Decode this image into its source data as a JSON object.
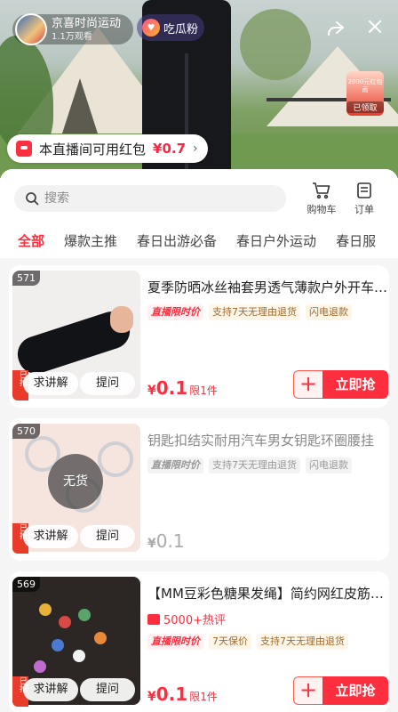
{
  "live": {
    "anchor_name": "京喜时尚运动",
    "anchor_views": "1.1万观看",
    "follow_label": "吃瓜粉",
    "redpack_amount": "2000元红包雨",
    "redpack_status": "已领取",
    "coupon_text": "本直播间可用红包",
    "coupon_amount": "¥0.7",
    "coupon_arrow": "›"
  },
  "sheet": {
    "search_placeholder": "搜索",
    "cart_label": "购物车",
    "orders_label": "订单",
    "tabs": [
      "全部",
      "爆款主推",
      "春日出游必备",
      "春日户外运动",
      "春日服"
    ]
  },
  "products": [
    {
      "rank": "571",
      "title": "夏季防晒冰丝袖套男透气薄款户外开车骑行",
      "tags": [
        "直播限时价",
        "支持7天无理由退货",
        "闪电退款"
      ],
      "price_symbol": "¥",
      "price": "0.1",
      "price_note": "限1件",
      "ask_label": "求讲解",
      "quiz_label": "提问",
      "buy_label": "立即抢",
      "add_label": "+",
      "side_tag": "已抢"
    },
    {
      "rank": "570",
      "title": "钥匙扣结实耐用汽车男女钥匙环圈腰挂",
      "tags": [
        "直播限时价",
        "支持7天无理由退货",
        "闪电退款"
      ],
      "price_symbol": "¥",
      "price": "0.1",
      "soldout_label": "无货",
      "ask_label": "求讲解",
      "quiz_label": "提问",
      "side_tag": "已抢"
    },
    {
      "rank": "569",
      "title": "【MM豆彩色糖果发绳】简约网红皮筋头绳",
      "hot": "5000+热评",
      "tags": [
        "直播限时价",
        "7天保价",
        "支持7天无理由退货"
      ],
      "price_symbol": "¥",
      "price": "0.1",
      "price_note": "限1件",
      "ask_label": "求讲解",
      "quiz_label": "提问",
      "buy_label": "立即抢",
      "add_label": "+",
      "side_tag": "已抢"
    }
  ],
  "colors": {
    "accent": "#ff2e3e",
    "tag_brown": "#a06a2c"
  }
}
